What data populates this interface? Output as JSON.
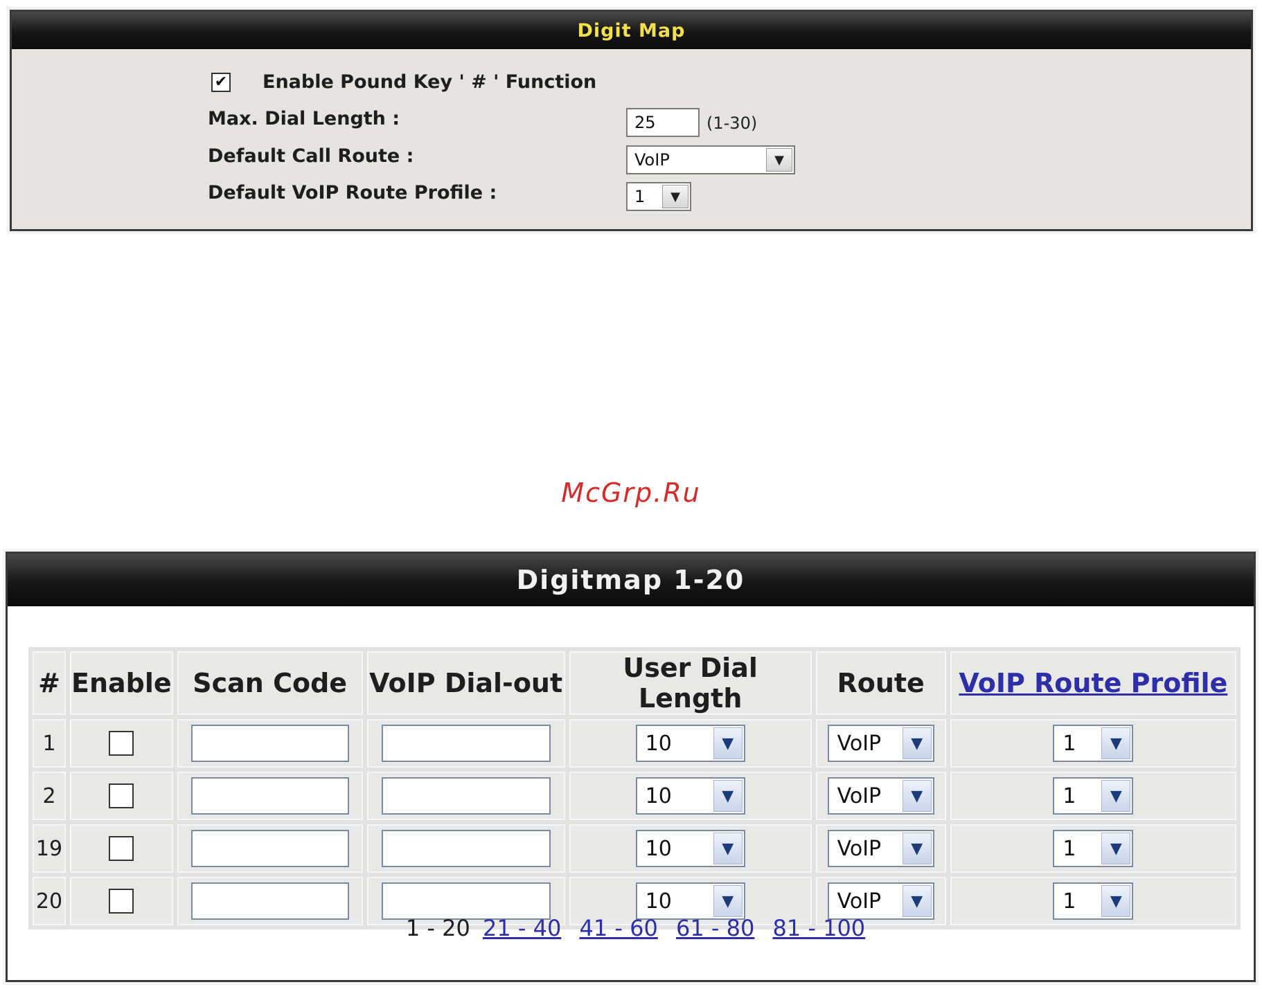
{
  "digit_map": {
    "title": "Digit Map",
    "pound_key_label": "Enable Pound Key ' # ' Function",
    "pound_key_checked": true,
    "max_dial_length_label": "Max. Dial Length :",
    "max_dial_length_value": "25",
    "max_dial_length_range": "(1-30)",
    "default_call_route_label": "Default Call Route :",
    "default_call_route_value": "VoIP",
    "default_voip_profile_label": "Default VoIP Route Profile :",
    "default_voip_profile_value": "1"
  },
  "watermark": "McGrp.Ru",
  "digitmap_table": {
    "title": "Digitmap 1-20",
    "headers": {
      "num": "#",
      "enable": "Enable",
      "scan_code": "Scan Code",
      "voip_dial_out": "VoIP Dial-out",
      "user_dial_length": "User Dial Length",
      "route": "Route",
      "voip_route_profile": "VoIP Route Profile"
    },
    "rows": [
      {
        "num": "1",
        "enabled": false,
        "scan_code": "",
        "dial_out": "",
        "dial_length": "10",
        "route": "VoIP",
        "profile": "1"
      },
      {
        "num": "2",
        "enabled": false,
        "scan_code": "",
        "dial_out": "",
        "dial_length": "10",
        "route": "VoIP",
        "profile": "1"
      },
      {
        "num": "19",
        "enabled": false,
        "scan_code": "",
        "dial_out": "",
        "dial_length": "10",
        "route": "VoIP",
        "profile": "1"
      },
      {
        "num": "20",
        "enabled": false,
        "scan_code": "",
        "dial_out": "",
        "dial_length": "10",
        "route": "VoIP",
        "profile": "1"
      }
    ],
    "pager": {
      "current": "1 - 20",
      "links": [
        "21 - 40",
        "41 - 60",
        "61 - 80",
        "81 - 100"
      ]
    }
  },
  "icons": {
    "check": "checkmark-icon",
    "dropdown": "chevron-down-icon"
  }
}
